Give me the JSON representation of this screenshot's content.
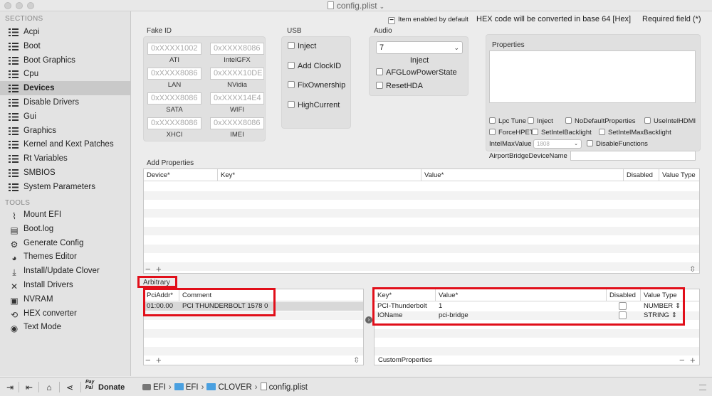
{
  "window": {
    "title": "config.plist"
  },
  "sidebar": {
    "sections_label": "SECTIONS",
    "sections": [
      {
        "label": "Acpi",
        "icon": "list-icon",
        "selected": false
      },
      {
        "label": "Boot",
        "icon": "list-icon",
        "selected": false
      },
      {
        "label": "Boot Graphics",
        "icon": "list-icon",
        "selected": false
      },
      {
        "label": "Cpu",
        "icon": "list-icon",
        "selected": false
      },
      {
        "label": "Devices",
        "icon": "list-icon",
        "selected": true
      },
      {
        "label": "Disable Drivers",
        "icon": "list-icon",
        "selected": false
      },
      {
        "label": "Gui",
        "icon": "list-icon",
        "selected": false
      },
      {
        "label": "Graphics",
        "icon": "list-icon",
        "selected": false
      },
      {
        "label": "Kernel and Kext Patches",
        "icon": "list-icon",
        "selected": false
      },
      {
        "label": "Rt Variables",
        "icon": "list-icon",
        "selected": false
      },
      {
        "label": "SMBIOS",
        "icon": "list-icon",
        "selected": false
      },
      {
        "label": "System Parameters",
        "icon": "list-icon",
        "selected": false
      }
    ],
    "tools_label": "TOOLS",
    "tools": [
      {
        "label": "Mount EFI",
        "icon": "mount-icon",
        "glyph": "⌇"
      },
      {
        "label": "Boot.log",
        "icon": "log-icon",
        "glyph": "▤"
      },
      {
        "label": "Generate Config",
        "icon": "gears-icon",
        "glyph": "⚙"
      },
      {
        "label": "Themes Editor",
        "icon": "palette-icon",
        "glyph": "◕"
      },
      {
        "label": "Install/Update Clover",
        "icon": "install-icon",
        "glyph": "⤓"
      },
      {
        "label": "Install Drivers",
        "icon": "wrench-icon",
        "glyph": "✕"
      },
      {
        "label": "NVRAM",
        "icon": "chip-icon",
        "glyph": "▣"
      },
      {
        "label": "HEX converter",
        "icon": "converter-icon",
        "glyph": "⟲"
      },
      {
        "label": "Text Mode",
        "icon": "eye-icon",
        "glyph": "◉"
      }
    ]
  },
  "info": {
    "item_enabled": "Item enabled by default",
    "hex_note": "HEX code will be converted in base 64 [Hex]",
    "required": "Required field (*)"
  },
  "fake_id": {
    "title": "Fake ID",
    "fields": [
      {
        "placeholder": "0xXXXX1002",
        "label": "ATI"
      },
      {
        "placeholder": "0xXXXX8086",
        "label": "IntelGFX"
      },
      {
        "placeholder": "0xXXXX8086",
        "label": "LAN"
      },
      {
        "placeholder": "0xXXXX10DE",
        "label": "NVidia"
      },
      {
        "placeholder": "0xXXXX8086",
        "label": "SATA"
      },
      {
        "placeholder": "0xXXXX14E4",
        "label": "WIFI"
      },
      {
        "placeholder": "0xXXXX8086",
        "label": "XHCI"
      },
      {
        "placeholder": "0xXXXX8086",
        "label": "IMEI"
      }
    ]
  },
  "usb": {
    "title": "USB",
    "options": [
      "Inject",
      "Add ClockID",
      "FixOwnership",
      "HighCurrent"
    ]
  },
  "audio": {
    "title": "Audio",
    "inject_value": "7",
    "inject_label": "Inject",
    "options": [
      "AFGLowPowerState",
      "ResetHDA"
    ]
  },
  "properties": {
    "title": "Properties",
    "checks_row1": [
      "Lpc Tune",
      "Inject",
      "NoDefaultProperties",
      "UseIntelHDMI"
    ],
    "checks_row2": [
      "ForceHPET",
      "SetIntelBacklight",
      "SetIntelMaxBacklight"
    ],
    "intel_max_label": "IntelMaxValue",
    "intel_max_placeholder": "1808",
    "disable_functions": "DisableFunctions",
    "airport_label": "AirportBridgeDeviceName"
  },
  "add_properties": {
    "title": "Add Properties",
    "columns": [
      "Device*",
      "Key*",
      "Value*",
      "Disabled",
      "Value Type"
    ]
  },
  "arbitrary": {
    "title": "Arbitrary",
    "columns": [
      "PciAddr*",
      "Comment"
    ],
    "rows": [
      {
        "pci_addr": "01:00.00",
        "comment": "PCI THUNDERBOLT 1578 0"
      }
    ]
  },
  "custom_properties": {
    "title": "CustomProperties",
    "columns": [
      "Key*",
      "Value*",
      "Disabled",
      "Value Type"
    ],
    "rows": [
      {
        "key": "PCI-Thunderbolt",
        "value": "1",
        "disabled": false,
        "type": "NUMBER"
      },
      {
        "key": "IOName",
        "value": "pci-bridge",
        "disabled": false,
        "type": "STRING"
      }
    ]
  },
  "bottom_bar": {
    "paypal": "Pay Pal",
    "donate": "Donate",
    "path": [
      "EFI",
      "EFI",
      "CLOVER",
      "config.plist"
    ]
  },
  "colors": {
    "highlight": "#e10f1a",
    "folder": "#4aa0e0"
  }
}
